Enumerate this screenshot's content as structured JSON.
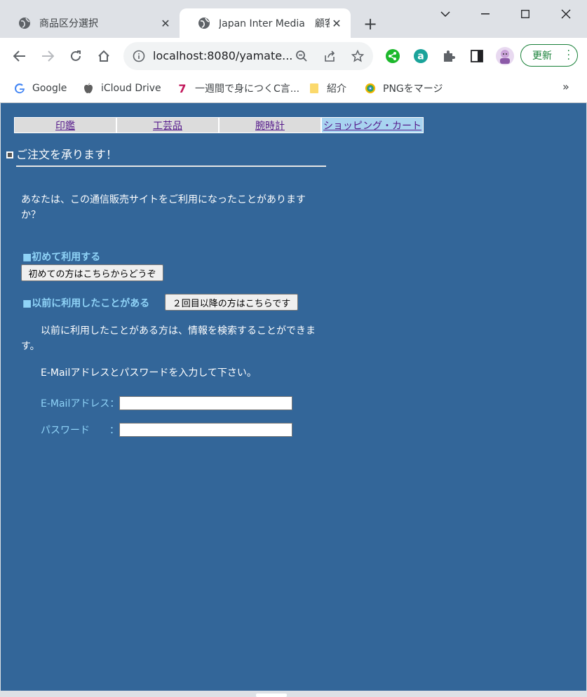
{
  "browser": {
    "tabs": [
      {
        "title": "商品区分選択",
        "icon": "globe-icon"
      },
      {
        "title": "Japan Inter Media　顧客",
        "icon": "globe-icon"
      }
    ],
    "new_tab_icon": "plus-icon",
    "window_controls": [
      "chevron-down-icon",
      "minimize-icon",
      "maximize-icon",
      "close-icon"
    ],
    "address": "localhost:8080/yamate...",
    "update_label": "更新",
    "bookmarks": [
      {
        "label": "Google",
        "icon": "google-icon"
      },
      {
        "label": "iCloud Drive",
        "icon": "apple-icon"
      },
      {
        "label": "一週間で身につくC言...",
        "icon": "seven-icon"
      },
      {
        "label": "紹介",
        "icon": "folder-icon"
      },
      {
        "label": "PNGをマージ",
        "icon": "png-merge-icon"
      }
    ],
    "bookmarks_more": "»"
  },
  "page": {
    "menu": [
      "印鑑",
      "工芸品",
      "腕時計",
      "ショッピング・カート"
    ],
    "heading": "ご注文を承ります！",
    "question": "あなたは、この通信販売サイトをご利用になったことがありますか？",
    "first_label": "■初めて利用する",
    "first_button": "初めての方はこちらからどうぞ",
    "prev_label": "■以前に利用したことがある",
    "prev_button": "２回目以降の方はこちらです",
    "search_note": "以前に利用したことがある方は、情報を検索することができます。",
    "instruction": "E-Mailアドレスとパスワードを入力して下さい。",
    "email_label": "E-Mailアドレス：",
    "password_label": "パスワード　　：",
    "email_value": "",
    "password_value": ""
  },
  "colors": {
    "page_bg": "#336699",
    "accent_label": "#8fd3f7",
    "cart_tab": "#a8d4f0",
    "update_green": "#188038"
  }
}
